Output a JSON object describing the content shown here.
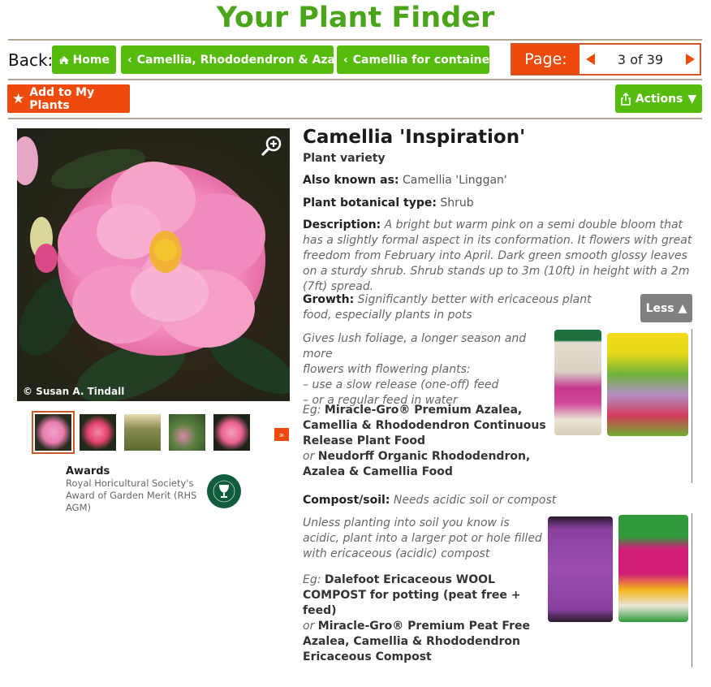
{
  "header": {
    "title": "Your Plant Finder"
  },
  "nav": {
    "back_label": "Back:",
    "breadcrumbs": [
      {
        "label": "Home",
        "icon": "home-icon"
      },
      {
        "label": "Camellia, Rhododendron & Azalea",
        "icon": "chevron-left-icon"
      },
      {
        "label": "Camellia for containers",
        "icon": "chevron-left-icon"
      }
    ],
    "pager": {
      "label": "Page:",
      "value": "3 of 39",
      "current": 3,
      "total": 39
    }
  },
  "toolbar": {
    "add_label": "Add to My Plants",
    "actions_label": "Actions"
  },
  "gallery": {
    "credit": "© Susan A. Tindall",
    "thumb_count": 5,
    "selected_thumb": 0,
    "next_glyph": "»"
  },
  "awards": {
    "heading": "Awards",
    "text": "Royal Horicultural Society's Award of Garden Merit (RHS AGM)",
    "badge": "RHS AWARD OF GARDEN MERIT"
  },
  "plant": {
    "name": "Camellia 'Inspiration'",
    "kind": "Plant variety",
    "aka_label": "Also known as:",
    "aka": "Camellia 'Linggan'",
    "type_label": "Plant botanical type:",
    "type": "Shrub",
    "desc_label": "Description:",
    "desc": "A bright but warm pink on a semi double bloom that has a slightly formal aspect in its conformation. It flowers with great freedom from February into April. Dark green smooth glossy leaves on a sturdy shrub. Shrub stands up to 3m (10ft) in height with a 2m (7ft) spread."
  },
  "growth": {
    "label": "Growth:",
    "summary": "Significantly better with ericaceous plant food, especially plants in pots",
    "less_label": "Less",
    "detail_lines": [
      "Gives lush foliage, a longer season and more",
      "flowers with flowering plants:",
      "– use a slow release (one-off) feed",
      "– or a regular feed in water"
    ],
    "eg": "Eg:",
    "product1": "Miracle-Gro® Premium Azalea, Camellia & Rhododendron Continuous Release Plant Food",
    "or": "or",
    "product2": "Neudorff Organic Rhododendron, Azalea & Camellia Food"
  },
  "compost": {
    "label": "Compost/soil:",
    "summary": "Needs acidic soil or compost",
    "detail": "Unless planting into soil you know is acidic, plant into a larger pot or hole filled with ericaceous (acidic) compost",
    "eg": "Eg:",
    "product1": "Dalefoot Ericaceous WOOL COMPOST for potting (peat free + feed)",
    "or": "or",
    "product2": "Miracle-Gro® Premium Peat Free Azalea, Camellia & Rhododendron Ericaceous Compost"
  }
}
